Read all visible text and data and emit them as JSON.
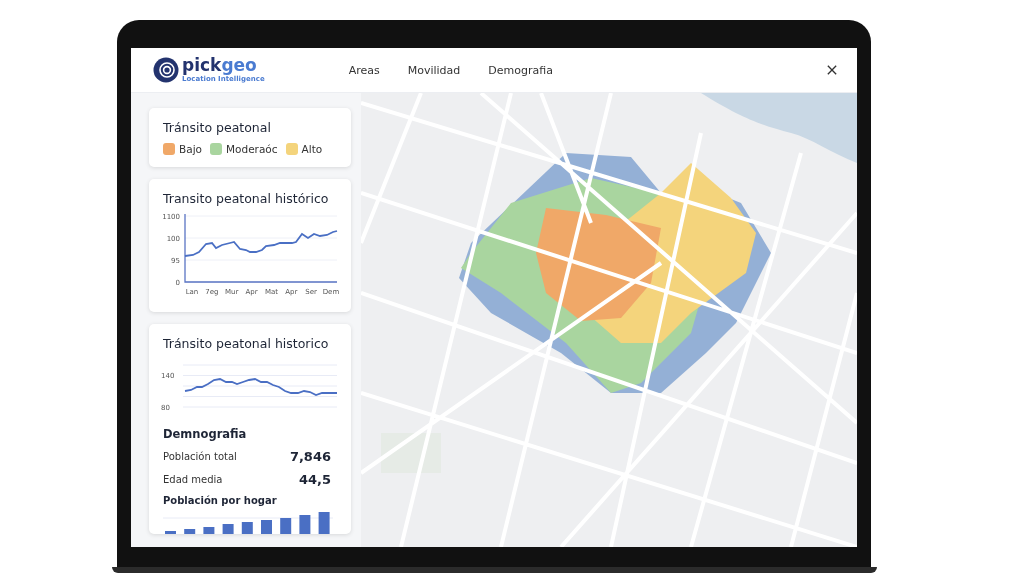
{
  "header": {
    "logo": {
      "name_dark": "pick",
      "name_accent": "geo",
      "tagline": "Location Intelligence"
    },
    "nav": [
      {
        "label": "Areas"
      },
      {
        "label": "Movilidad"
      },
      {
        "label": "Demografia"
      }
    ]
  },
  "sidebar": {
    "legend_card": {
      "title": "Tránsito peatonal",
      "items": [
        {
          "label": "Bajo",
          "color": "#f0a868"
        },
        {
          "label": "Moderaóc",
          "color": "#a9d59f"
        },
        {
          "label": "Alto",
          "color": "#f4d47c"
        }
      ]
    },
    "history_card": {
      "title": "Transito peatonal histórico",
      "y_labels": [
        "1100",
        "100",
        "95",
        "0"
      ],
      "x_labels": [
        "Lan",
        "7eg",
        "Mur",
        "Apr",
        "Mat",
        "Apr",
        "Ser",
        "Dem"
      ]
    },
    "demo_card": {
      "title": "Tránsito peatonal historico",
      "y_labels": [
        "140",
        "80"
      ],
      "section_title": "Demnografia",
      "stats": [
        {
          "label": "Población total",
          "value": "7,846"
        },
        {
          "label": "Edad media",
          "value": "44,5"
        }
      ],
      "bar_title": "Población por hogar"
    }
  }
}
